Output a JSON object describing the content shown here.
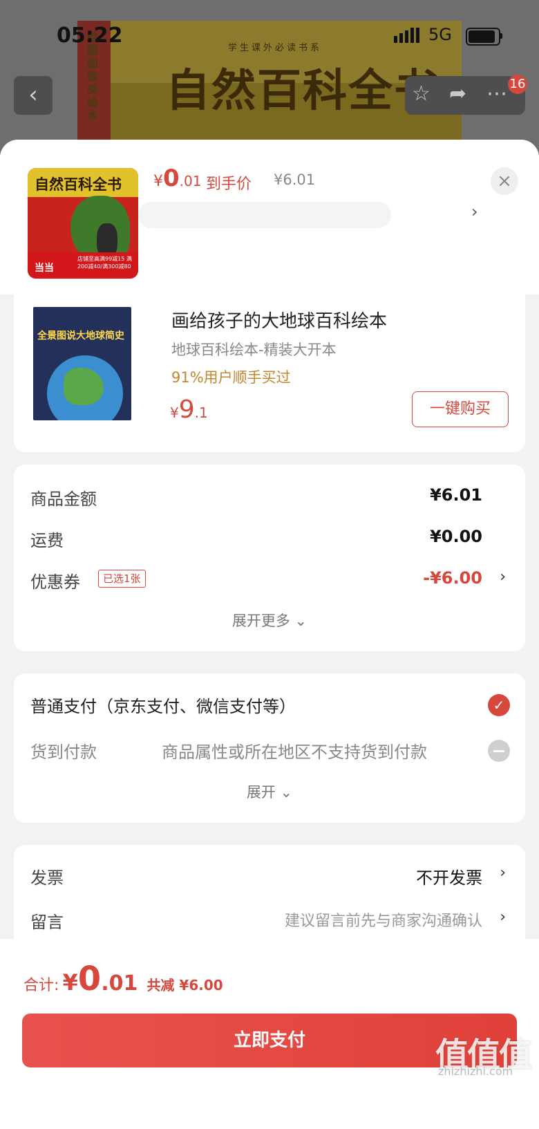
{
  "status_bar": {
    "time": "05:22",
    "network": "5G"
  },
  "background": {
    "book_title": "自然百科全书",
    "book_subtitle": "学生课外必读书系",
    "book_spine": "绘图图鉴美绘本",
    "notification_count": "16"
  },
  "sheet": {
    "product": {
      "thumb_title": "自然百科全书",
      "thumb_brand": "当当",
      "thumb_promo": "店铺至高满99减15 满200减40/满300减80",
      "price_yen": "¥",
      "price_int": "0",
      "price_dec": ".01",
      "price_label": "到手价",
      "original_price": "¥6.01"
    },
    "recommendation": {
      "cover_text": "全景图说大地球简史",
      "title": "画给孩子的大地球百科绘本",
      "subtitle": "地球百科绘本-精装大开本",
      "stat": "91%用户顺手买过",
      "price_yen": "¥",
      "price_int": "9",
      "price_dec": ".1",
      "buy_button": "一键购买"
    },
    "summary": {
      "goods_amount_label": "商品金额",
      "goods_amount_value": "¥6.01",
      "shipping_label": "运费",
      "shipping_value": "¥0.00",
      "coupon_label": "优惠券",
      "coupon_tag": "已选1张",
      "coupon_value": "-¥6.00",
      "expand_more": "展开更多"
    },
    "payment": {
      "normal_pay": "普通支付（京东支付、微信支付等）",
      "cod_label": "货到付款",
      "cod_note": "商品属性或所在地区不支持货到付款",
      "expand": "展开"
    },
    "misc": {
      "invoice_label": "发票",
      "invoice_value": "不开发票",
      "message_label": "留言",
      "message_placeholder": "建议留言前先与商家沟通确认"
    }
  },
  "footer": {
    "total_label": "合计:",
    "total_yen": "¥",
    "total_int": "0",
    "total_dec": ".01",
    "total_reduced": "共减 ¥6.00",
    "pay_button": "立即支付",
    "watermark": "值值值",
    "watermark_url": "zhizhizhi.com"
  },
  "colors": {
    "accent": "#d6473c",
    "highlight": "#c4862a"
  }
}
